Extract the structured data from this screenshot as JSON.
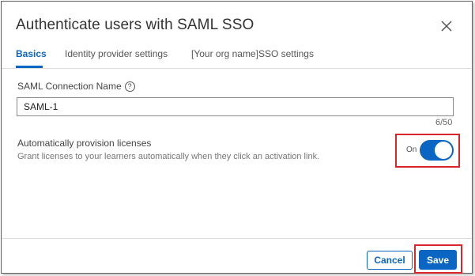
{
  "dialog": {
    "title": "Authenticate users with SAML SSO"
  },
  "tabs": [
    {
      "label": "Basics",
      "active": true
    },
    {
      "label": "Identity provider settings",
      "active": false
    },
    {
      "label": "[Your org name]SSO settings",
      "active": false
    }
  ],
  "connection": {
    "label": "SAML Connection Name",
    "help_icon": "?",
    "value": "SAML-1",
    "counter": "6/50"
  },
  "provision": {
    "title": "Automatically provision licenses",
    "description": "Grant licenses to your learners automatically when they click an activation link.",
    "toggle_label": "On",
    "toggle_on": true
  },
  "footer": {
    "cancel_label": "Cancel",
    "save_label": "Save"
  },
  "colors": {
    "accent": "#0a66c2",
    "highlight": "#d9262c"
  },
  "icons": {
    "close": "close-icon",
    "help": "help-circle-icon"
  }
}
